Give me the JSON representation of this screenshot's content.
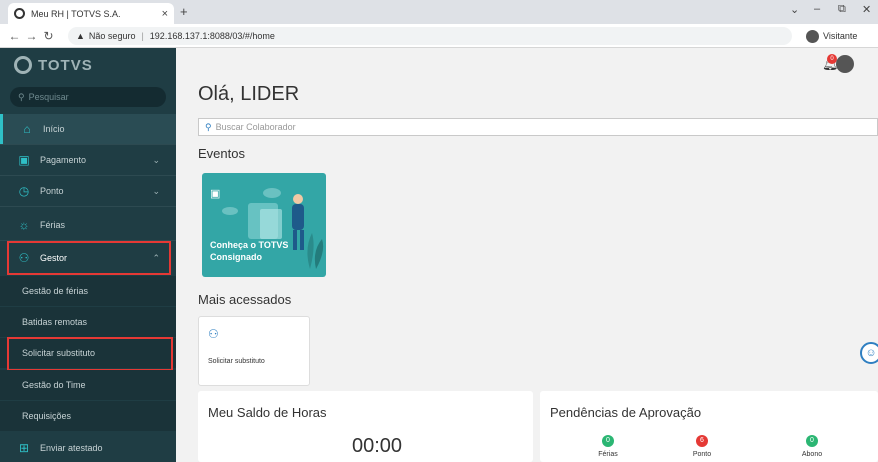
{
  "browser": {
    "tab_title": "Meu RH | TOTVS S.A.",
    "tab_close": "×",
    "new_tab": "+",
    "security_warning": "Não seguro",
    "url": "192.168.137.1:8088/03/#/home",
    "profile": "Visitante",
    "win_minimize": "–",
    "win_restore": "⧉",
    "win_close": "✕"
  },
  "sidebar": {
    "logo": "TOTVS",
    "search_placeholder": "Pesquisar",
    "items": [
      {
        "label": "Início",
        "icon": "home-icon"
      },
      {
        "label": "Pagamento",
        "icon": "wallet-icon"
      },
      {
        "label": "Ponto",
        "icon": "clock-icon"
      },
      {
        "label": "Férias",
        "icon": "sun-icon"
      },
      {
        "label": "Gestor",
        "icon": "manager-icon"
      },
      {
        "label": "Gestão de férias"
      },
      {
        "label": "Batidas remotas"
      },
      {
        "label": "Solicitar substituto"
      },
      {
        "label": "Gestão do Time"
      },
      {
        "label": "Requisições"
      },
      {
        "label": "Enviar atestado",
        "icon": "upload-icon"
      }
    ]
  },
  "header": {
    "notification_count": "0"
  },
  "main": {
    "greeting": "Olá, LIDER",
    "collab_search_placeholder": "Buscar Colaborador",
    "events_title": "Eventos",
    "event_card_label": "Conheça o TOTVS Consignado",
    "most_accessed_title": "Mais acessados",
    "access_card_label": "Solicitar substituto",
    "hours_panel_title": "Meu Saldo de Horas",
    "hours_value": "00:00",
    "pending_title": "Pendências de Aprovação",
    "pending": [
      {
        "label": "Férias",
        "count": "0",
        "color": "#2bb673"
      },
      {
        "label": "Ponto",
        "count": "6",
        "color": "#e53935"
      },
      {
        "label": "Abono",
        "count": "0",
        "color": "#2bb673"
      }
    ]
  }
}
